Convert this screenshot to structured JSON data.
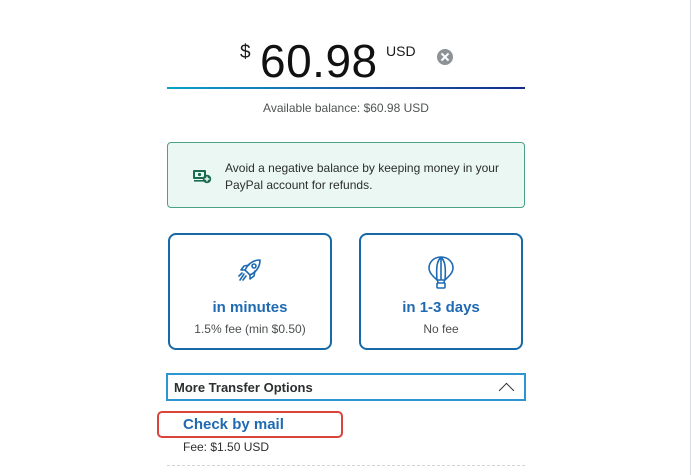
{
  "amount": {
    "currency_symbol": "$",
    "value": "60.98",
    "currency_code": "USD"
  },
  "balance_text": "Available balance: $60.98 USD",
  "notice": {
    "icon": "money-refund-icon",
    "text": "Avoid a negative balance by keeping money in your PayPal account for refunds."
  },
  "speed_options": [
    {
      "icon": "rocket-icon",
      "title": "in minutes",
      "subtitle": "1.5% fee (min $0.50)"
    },
    {
      "icon": "hot-air-balloon-icon",
      "title": "in 1-3 days",
      "subtitle": "No fee"
    }
  ],
  "more_options": {
    "label": "More Transfer Options",
    "icon": "chevron-up-icon"
  },
  "check_option": {
    "title": "Check by mail",
    "fee": "Fee: $1.50 USD"
  },
  "colors": {
    "accent_blue": "#1f6ab2",
    "card_border": "#1869a8",
    "notice_border": "#4aa286",
    "notice_bg": "#eaf7f2",
    "highlight_red": "#d9453a"
  }
}
